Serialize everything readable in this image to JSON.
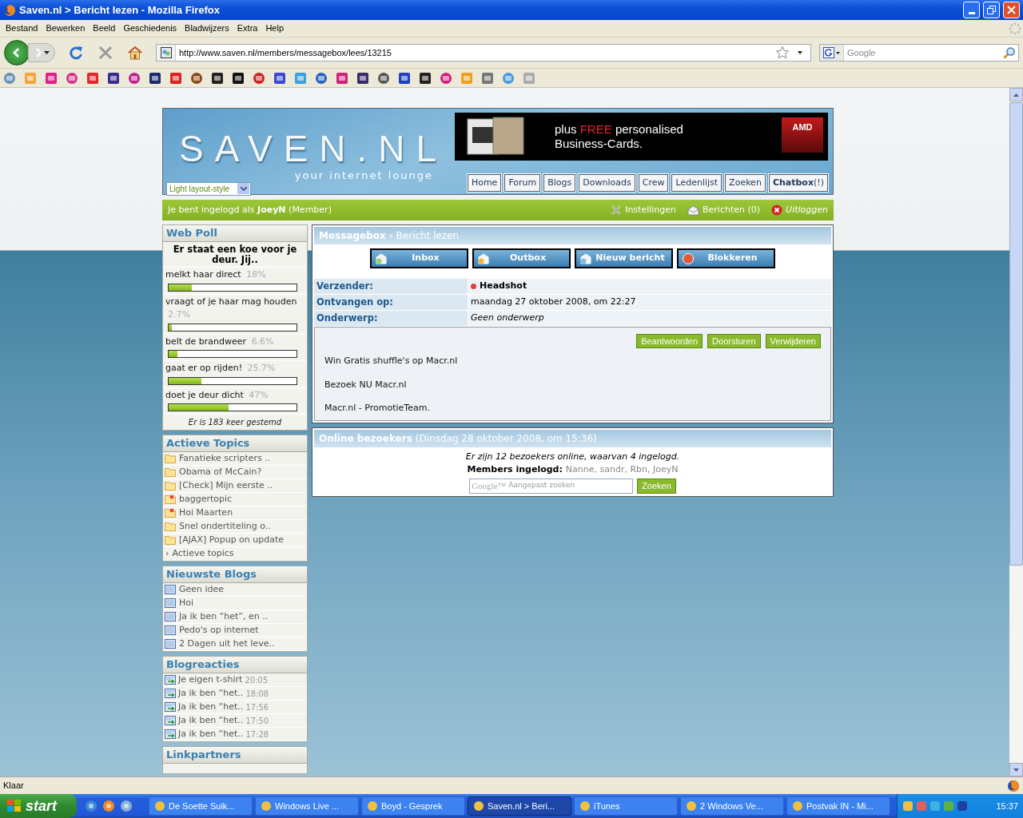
{
  "window": {
    "title": "Saven.nl > Bericht lezen - Mozilla Firefox"
  },
  "menu": [
    "Bestand",
    "Bewerken",
    "Beeld",
    "Geschiedenis",
    "Bladwijzers",
    "Extra",
    "Help"
  ],
  "toolbar": {
    "url": "http://www.saven.nl/members/messagebox/lees/13215",
    "search_placeholder": "Google"
  },
  "site": {
    "logo": "SAVEN.NL",
    "tagline": "your internet lounge",
    "style_select": "Light layout-style",
    "ad": {
      "before": "plus",
      "highlight": "FREE",
      "after": "personalised",
      "line2": "Business-Cards.",
      "brand": "AMD"
    },
    "nav": [
      {
        "label": "Home"
      },
      {
        "label": "Forum"
      },
      {
        "label": "Blogs"
      },
      {
        "label": "Downloads"
      },
      {
        "label": "Crew"
      },
      {
        "label": "Ledenlijst"
      },
      {
        "label": "Zoeken"
      },
      {
        "label": "**Chatbox**(!)"
      }
    ]
  },
  "userbar": {
    "text": "Je bent ingelogd als **JoeyN** (Member)",
    "links": [
      {
        "label": "Instellingen",
        "kind": "settings"
      },
      {
        "label": "Berichten (0)",
        "kind": "messages"
      },
      {
        "label": "Uitloggen",
        "kind": "logout"
      }
    ]
  },
  "poll": {
    "title": "Web Poll",
    "question": "Er staat een koe voor je deur. Jij..",
    "options": [
      {
        "label": "melkt haar direct",
        "reading": "18%",
        "level": 0.18
      },
      {
        "label": "vraagt of je haar mag houden",
        "reading": "2.7%",
        "level": 0.027
      },
      {
        "label": "belt de brandweer",
        "reading": "6.6%",
        "level": 0.066
      },
      {
        "label": "gaat er op rijden!",
        "reading": "25.7%",
        "level": 0.257
      },
      {
        "label": "doet je deur dicht",
        "reading": "47%",
        "level": 0.47
      }
    ],
    "footer": "Er is 183 keer gestemd"
  },
  "topics": {
    "title": "Actieve Topics",
    "items": [
      {
        "label": "Fanatieke scripters ..",
        "kind": "folder"
      },
      {
        "label": "Obama of McCain?",
        "kind": "folder"
      },
      {
        "label": "[Check] Mijn eerste ..",
        "kind": "folder"
      },
      {
        "label": "baggertopic",
        "kind": "closed"
      },
      {
        "label": "Hoi Maarten",
        "kind": "closed"
      },
      {
        "label": "Snel ondertiteling o..",
        "kind": "folder"
      },
      {
        "label": "[AJAX] Popup on update",
        "kind": "folder"
      }
    ],
    "more_marker": "›",
    "more": "Actieve topics"
  },
  "blogs": {
    "title": "Nieuwste Blogs",
    "items": [
      "Geen idee",
      "Hoi",
      "Ja ik ben “het”, en ..",
      "Pedo's op internet",
      "2 Dagen uit het leve.."
    ]
  },
  "reactions": {
    "title": "Blogreacties",
    "items": [
      {
        "label": "Je eigen t-shirt",
        "time": "20:05"
      },
      {
        "label": "Ja ik ben “het..",
        "time": "18:08"
      },
      {
        "label": "Ja ik ben “het..",
        "time": "17:56"
      },
      {
        "label": "Ja ik ben “het..",
        "time": "17:50"
      },
      {
        "label": "Ja ik ben “het..",
        "time": "17:28"
      }
    ]
  },
  "linkpartners": {
    "title": "Linkpartners"
  },
  "message": {
    "breadcrumb": [
      "Messagebox",
      "Bericht lezen"
    ],
    "separator": "›",
    "buttons": [
      {
        "label": "Inbox",
        "kind": "inbox"
      },
      {
        "label": "Outbox",
        "kind": "outbox"
      },
      {
        "label": "Nieuw bericht",
        "kind": "new"
      },
      {
        "label": "Blokkeren",
        "kind": "block"
      }
    ],
    "fields": [
      {
        "label": "Verzender:",
        "value": "Headshot",
        "kind": "sender",
        "color": "#e04040"
      },
      {
        "label": "Ontvangen op:",
        "value": "maandag 27 oktober 2008, om 22:27",
        "kind": "date"
      },
      {
        "label": "Onderwerp:",
        "value": "Geen onderwerp",
        "kind": "subject"
      }
    ],
    "actions": [
      "Beantwoorden",
      "Doorsturen",
      "Verwijderen"
    ],
    "body": [
      "Win Gratis shuffle's op Macr.nl",
      "Bezoek NU Macr.nl",
      "Macr.nl - PromotieTeam."
    ]
  },
  "online": {
    "title": "Online bezoekers",
    "date": "(Dinsdag 28 oktober 2008, om 15:36)",
    "summary": "Er zijn 12 bezoekers online, waarvan 4 ingelogd.",
    "members_label": "Members ingelogd:",
    "members": "Nanne, sandr, Rbn, JoeyN",
    "google_logo": "Google™",
    "search_placeholder": "Aangepast zoeken",
    "search_button": "Zoeken"
  },
  "status": "Klaar",
  "taskbar": {
    "start": "start",
    "tasks": [
      {
        "label": "De Soette Suik...",
        "selected": false
      },
      {
        "label": "Windows Live ...",
        "selected": false
      },
      {
        "label": "Boyd - Gesprek",
        "selected": false
      },
      {
        "label": "Saven.nl > Beri...",
        "selected": true
      },
      {
        "label": "iTunes",
        "selected": false
      },
      {
        "label": "2 Windows Ve...",
        "selected": false
      },
      {
        "label": "Postvak IN - Mi...",
        "selected": false
      }
    ],
    "clock": "15:37"
  }
}
